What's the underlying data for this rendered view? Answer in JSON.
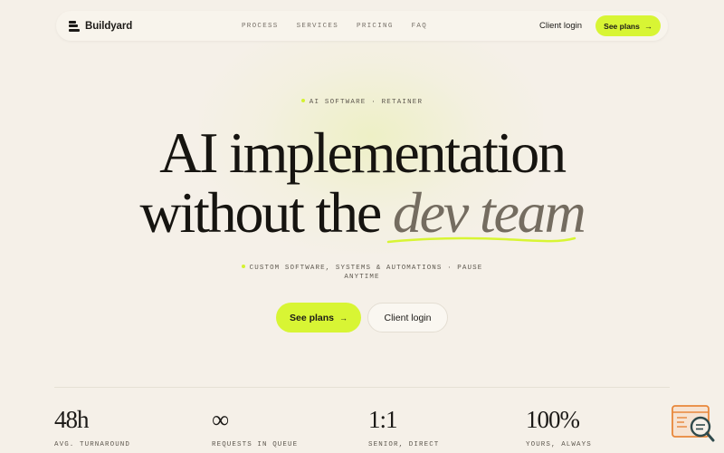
{
  "brand": {
    "name": "Buildyard",
    "icon": "stack-logo-icon"
  },
  "nav": {
    "links": [
      "PROCESS",
      "SERVICES",
      "PRICING",
      "FAQ"
    ],
    "login_label": "Client login",
    "cta_label": "See plans",
    "cta_icon": "arrow-right-icon"
  },
  "hero": {
    "eyebrow": "AI SOFTWARE · RETAINER",
    "line1": "AI implementation",
    "line2_prefix": "without the ",
    "line2_emphasis": "dev team",
    "subtitle": "CUSTOM SOFTWARE, SYSTEMS & AUTOMATIONS · PAUSE ANYTIME",
    "primary_cta": "See plans",
    "secondary_cta": "Client login"
  },
  "stats": [
    {
      "value": "48h",
      "label": "AVG. TURNAROUND"
    },
    {
      "value": "∞",
      "label": "REQUESTS IN QUEUE"
    },
    {
      "value": "1:1",
      "label": "SENIOR, DIRECT"
    },
    {
      "value": "100%",
      "label": "YOURS, ALWAYS"
    }
  ],
  "colors": {
    "accent": "#d8f534",
    "background": "#f5f0e8",
    "text": "#1c1a17",
    "emphasis": "#746c60",
    "widget": "#e8873a"
  },
  "widget": {
    "icon": "search-document-icon"
  }
}
